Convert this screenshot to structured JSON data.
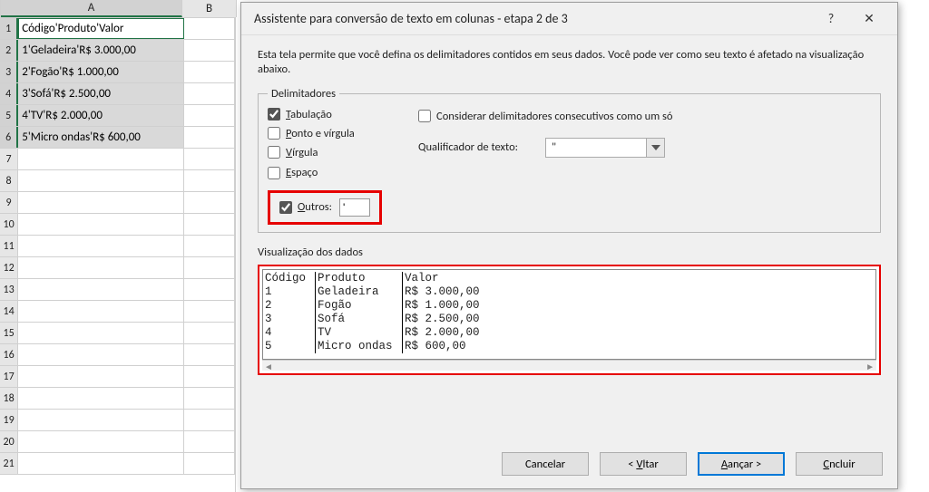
{
  "sheet": {
    "col_headers": [
      "A",
      "B"
    ],
    "rows": [
      {
        "n": 1,
        "A": "Código'Produto'Valor"
      },
      {
        "n": 2,
        "A": "1'Geladeira'R$ 3.000,00"
      },
      {
        "n": 3,
        "A": "2'Fogão'R$ 1.000,00"
      },
      {
        "n": 4,
        "A": "3'Sofá'R$ 2.500,00"
      },
      {
        "n": 5,
        "A": "4'TV'R$ 2.000,00"
      },
      {
        "n": 6,
        "A": "5'Micro ondas'R$ 600,00"
      },
      {
        "n": 7,
        "A": ""
      },
      {
        "n": 8,
        "A": ""
      },
      {
        "n": 9,
        "A": ""
      },
      {
        "n": 10,
        "A": ""
      },
      {
        "n": 11,
        "A": ""
      },
      {
        "n": 12,
        "A": ""
      },
      {
        "n": 13,
        "A": ""
      },
      {
        "n": 14,
        "A": ""
      },
      {
        "n": 15,
        "A": ""
      },
      {
        "n": 16,
        "A": ""
      },
      {
        "n": 17,
        "A": ""
      },
      {
        "n": 18,
        "A": ""
      },
      {
        "n": 19,
        "A": ""
      },
      {
        "n": 20,
        "A": ""
      },
      {
        "n": 21,
        "A": ""
      }
    ],
    "selected_rows_end": 6
  },
  "dialog": {
    "title": "Assistente para conversão de texto em colunas - etapa 2 de 3",
    "help_icon": "?",
    "close_icon": "✕",
    "intro": "Esta tela permite que você defina os delimitadores contidos em seus dados. Você pode ver como seu texto é afetado na visualização abaixo.",
    "delimiters": {
      "legend": "Delimitadores",
      "tab": "Tabulação",
      "semicolon": "Ponto e vírgula",
      "comma": "Vírgula",
      "space": "Espaço",
      "other": "Outros:",
      "other_value": "'",
      "tab_checked": true,
      "semicolon_checked": false,
      "comma_checked": false,
      "space_checked": false,
      "other_checked": true
    },
    "consecutive": "Considerar delimitadores consecutivos como um só",
    "consecutive_checked": false,
    "qualifier_label": "Qualificador de texto:",
    "qualifier_value": "\"",
    "preview_label": "Visualização dos dados",
    "preview_cols": [
      "Código",
      "Produto",
      "Valor"
    ],
    "preview_rows": [
      [
        "1",
        "Geladeira",
        "R$ 3.000,00"
      ],
      [
        "2",
        "Fogão",
        "R$ 1.000,00"
      ],
      [
        "3",
        "Sofá",
        "R$ 2.500,00"
      ],
      [
        "4",
        "TV",
        "R$ 2.000,00"
      ],
      [
        "5",
        "Micro ondas",
        "R$ 600,00"
      ]
    ],
    "buttons": {
      "cancel": "Cancelar",
      "back": "< Voltar",
      "next": "Avançar >",
      "finish": "Concluir"
    }
  }
}
